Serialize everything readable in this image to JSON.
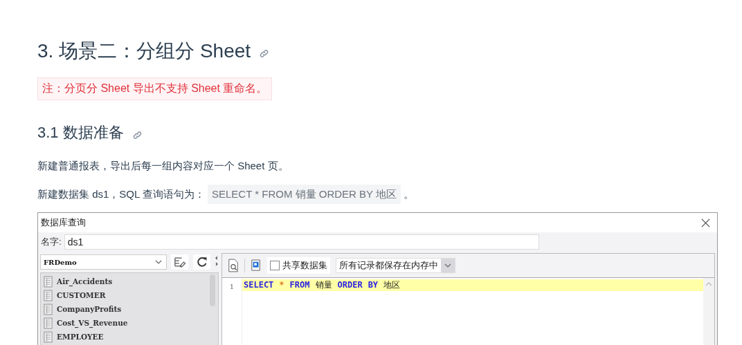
{
  "heading": "3. 场景二：分组分 Sheet",
  "note": "注：分页分 Sheet 导出不支持 Sheet 重命名。",
  "subheading": "3.1 数据准备",
  "paragraph_1": "新建普通报表，导出后每一组内容对应一个 Sheet 页。",
  "paragraph_2": {
    "text": "新建数据集 ds1，SQL 查询语句为：",
    "code": "SELECT * FROM 销量 ORDER BY 地区",
    "after": "。"
  },
  "dialog": {
    "title": "数据库查询",
    "name_label": "名字:",
    "name_value": "ds1",
    "datasource": "FRDemo",
    "tables": [
      "Air_Accidents",
      "CUSTOMER",
      "CompanyProfits",
      "Cost_VS_Revenue",
      "EMPLOYEE"
    ],
    "shared_checkbox": {
      "label": "共享数据集",
      "checked": false
    },
    "storage_option": "所有记录都保存在内存中",
    "editor_lines": [
      {
        "number": "1",
        "highlighted": true,
        "tokens": [
          {
            "kind": "keyword",
            "text": "SELECT"
          },
          {
            "kind": "operator",
            "text": "*"
          },
          {
            "kind": "keyword",
            "text": "FROM"
          },
          {
            "kind": "identifier",
            "text": "销量"
          },
          {
            "kind": "keyword",
            "text": "ORDER"
          },
          {
            "kind": "keyword",
            "text": "BY"
          },
          {
            "kind": "identifier",
            "text": "地区"
          }
        ]
      }
    ]
  }
}
